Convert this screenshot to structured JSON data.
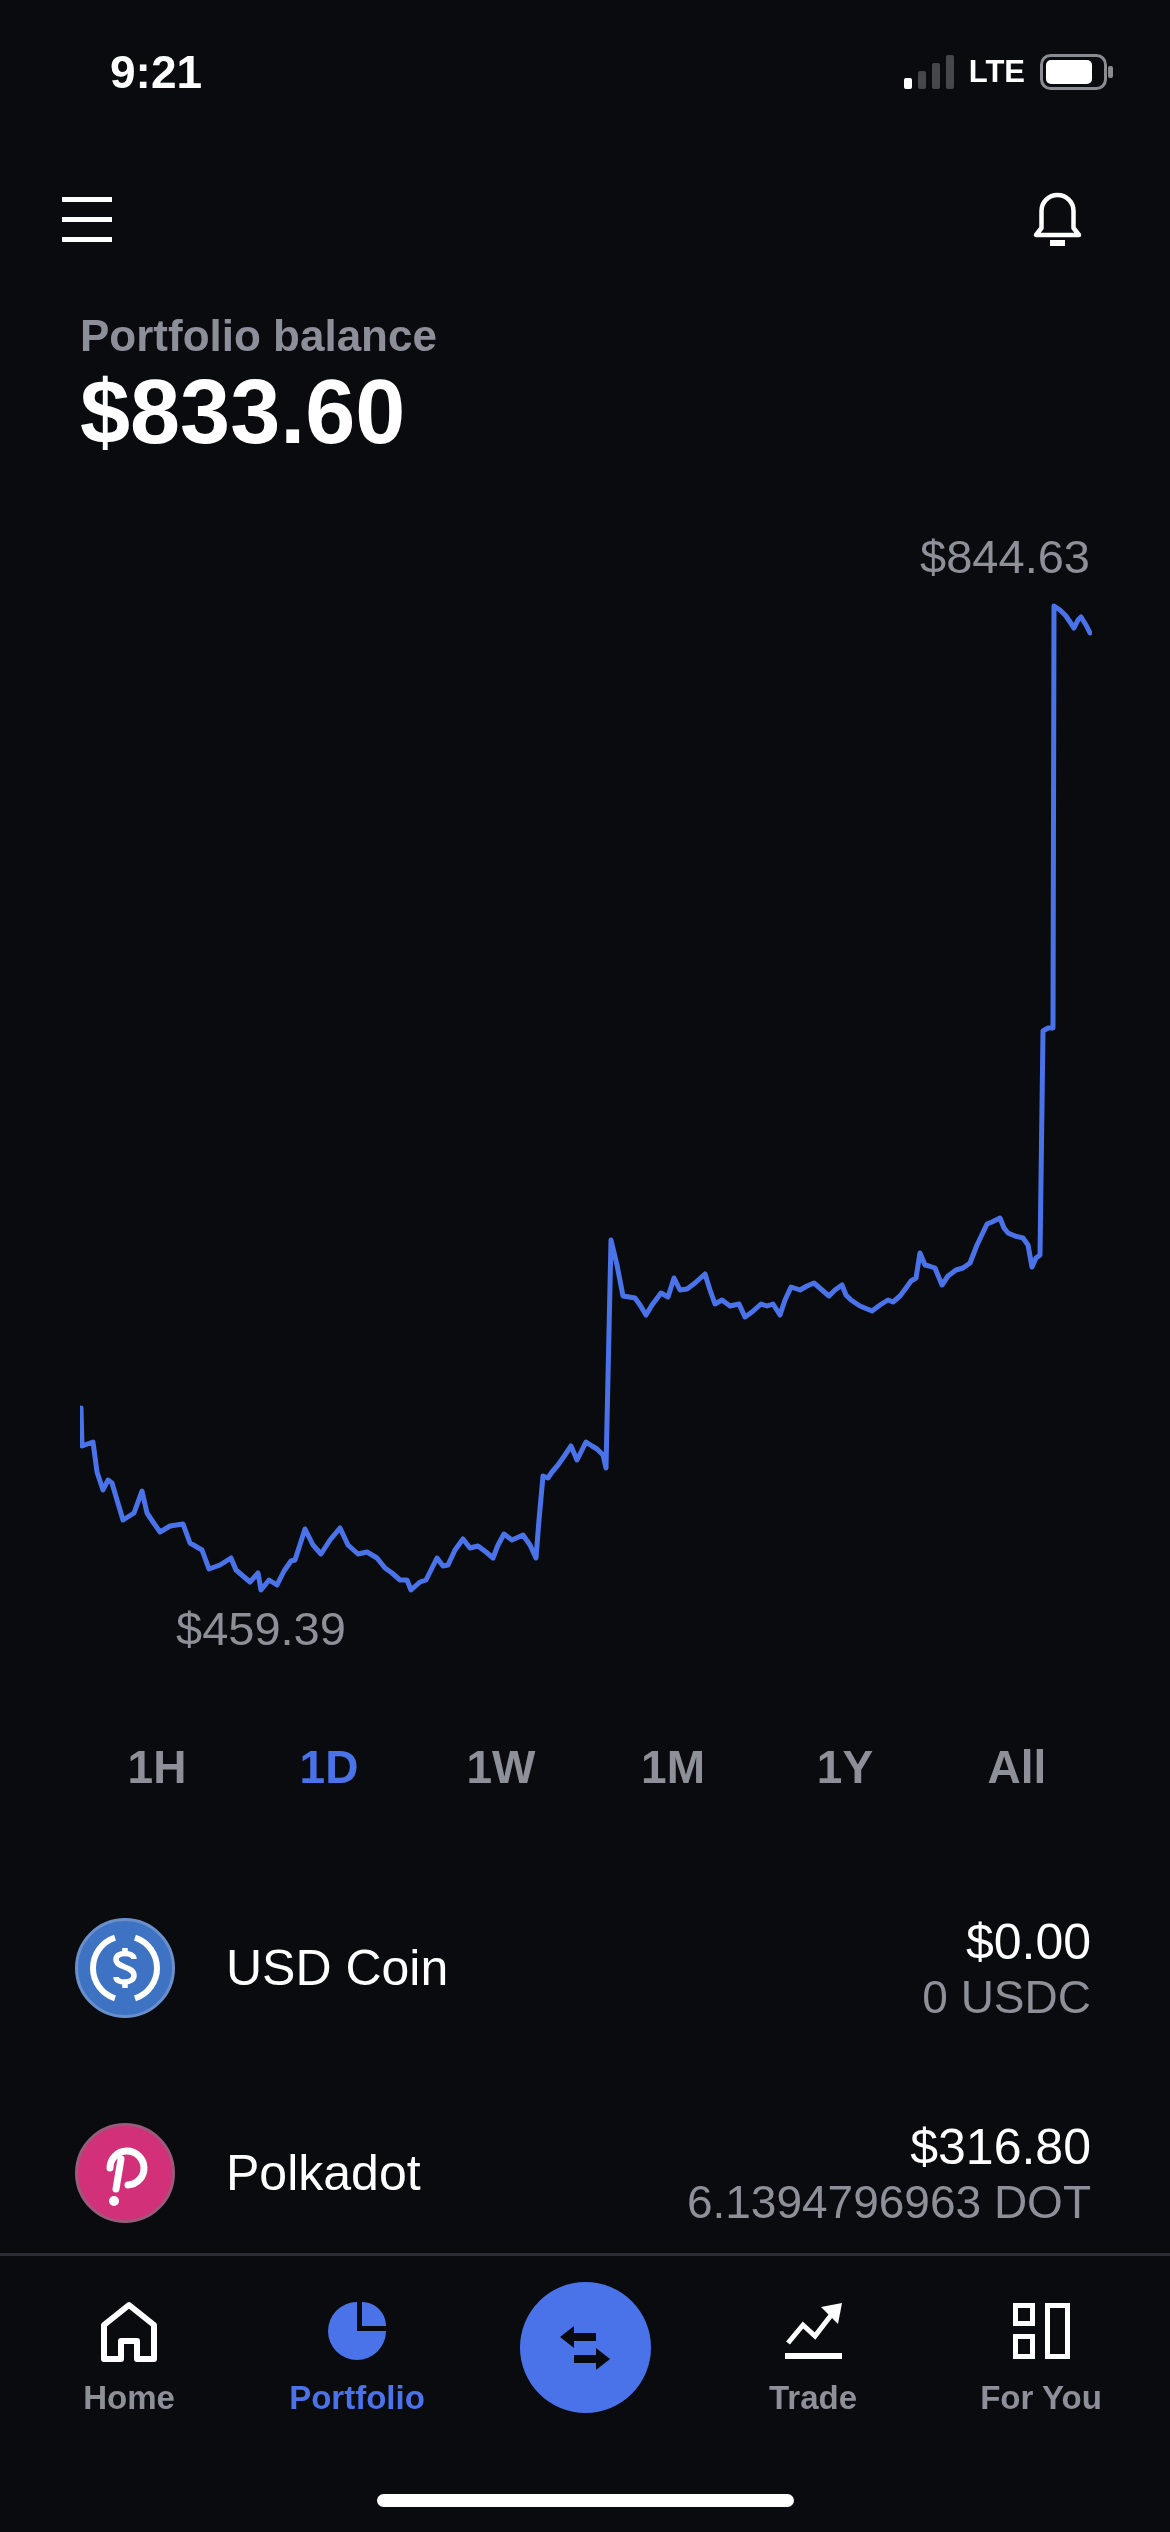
{
  "status_bar": {
    "time": "9:21",
    "network": "LTE"
  },
  "balance": {
    "label": "Portfolio balance",
    "value": "$833.60"
  },
  "chart": {
    "high_label": "$844.63",
    "low_label": "$459.39"
  },
  "time_ranges": [
    {
      "label": "1H",
      "selected": false
    },
    {
      "label": "1D",
      "selected": true
    },
    {
      "label": "1W",
      "selected": false
    },
    {
      "label": "1M",
      "selected": false
    },
    {
      "label": "1Y",
      "selected": false
    },
    {
      "label": "All",
      "selected": false
    }
  ],
  "assets": [
    {
      "kind": "usdc",
      "name": "USD Coin",
      "value": "$0.00",
      "amount": "0 USDC"
    },
    {
      "kind": "dot",
      "name": "Polkadot",
      "value": "$316.80",
      "amount": "6.1394796963 DOT"
    }
  ],
  "tabs": [
    {
      "kind": "home",
      "label": "Home",
      "selected": false
    },
    {
      "kind": "pie",
      "label": "Portfolio",
      "selected": true
    },
    {
      "kind": "trend",
      "label": "Trade",
      "selected": false
    },
    {
      "kind": "grid",
      "label": "For You",
      "selected": false
    }
  ]
}
